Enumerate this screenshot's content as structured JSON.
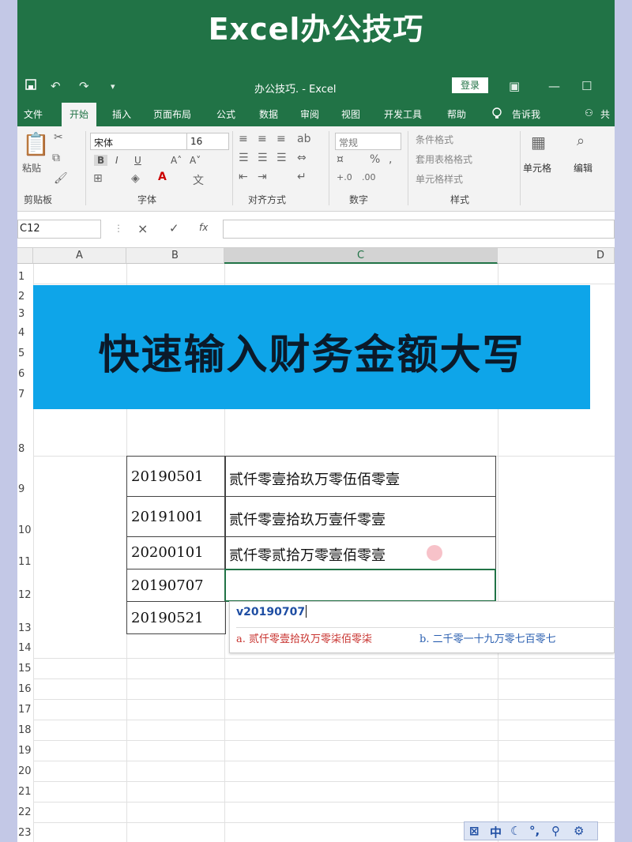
{
  "banner": {
    "title": "Excel办公技巧"
  },
  "titlebar": {
    "doc_title": "办公技巧. - Excel",
    "login_label": "登录",
    "save_icon": "save-icon",
    "undo_icon": "undo-icon",
    "redo_icon": "redo-icon"
  },
  "tabs": [
    "文件",
    "开始",
    "插入",
    "页面布局",
    "公式",
    "数据",
    "审阅",
    "视图",
    "开发工具",
    "帮助",
    "告诉我",
    "共"
  ],
  "ribbon": {
    "paste_label": "粘贴",
    "clipboard_label": "剪贴板",
    "font_name": "宋体",
    "font_size": "16",
    "bold": "B",
    "italic": "I",
    "underline": "U",
    "font_label": "字体",
    "align_label": "对齐方式",
    "number_format": "常规",
    "number_label": "数字",
    "cond_format": "条件格式",
    "table_format": "套用表格格式",
    "cell_style": "单元格样式",
    "style_label": "样式",
    "cells_label": "单元格",
    "edit_label": "编辑"
  },
  "formula_bar": {
    "name_box": "C12",
    "cancel": "×",
    "confirm": "✓",
    "fx": "fx"
  },
  "grid": {
    "columns": [
      "A",
      "B",
      "C",
      "D"
    ],
    "rows": [
      "1",
      "2",
      "3",
      "4",
      "5",
      "6",
      "7",
      "8",
      "9",
      "10",
      "11",
      "12",
      "13",
      "14",
      "15",
      "16",
      "17",
      "18",
      "19",
      "20",
      "21",
      "22",
      "23"
    ],
    "title": "快速输入财务金额大写",
    "data_rows": [
      {
        "num": "20190501",
        "text": "贰仟零壹拾玖万零伍佰零壹"
      },
      {
        "num": "20191001",
        "text": "贰仟零壹拾玖万壹仟零壹"
      },
      {
        "num": "20200101",
        "text": "贰仟零贰拾万零壹佰零壹"
      },
      {
        "num": "20190707",
        "text": ""
      },
      {
        "num": "20190521",
        "text": ""
      }
    ]
  },
  "ime": {
    "input": "v20190707",
    "candidate_a": "a. 贰仟零壹拾玖万零柒佰零柒",
    "candidate_b": "b. 二千零一十九万零七百零七"
  },
  "ime_toolbar": {
    "mode": "中"
  }
}
